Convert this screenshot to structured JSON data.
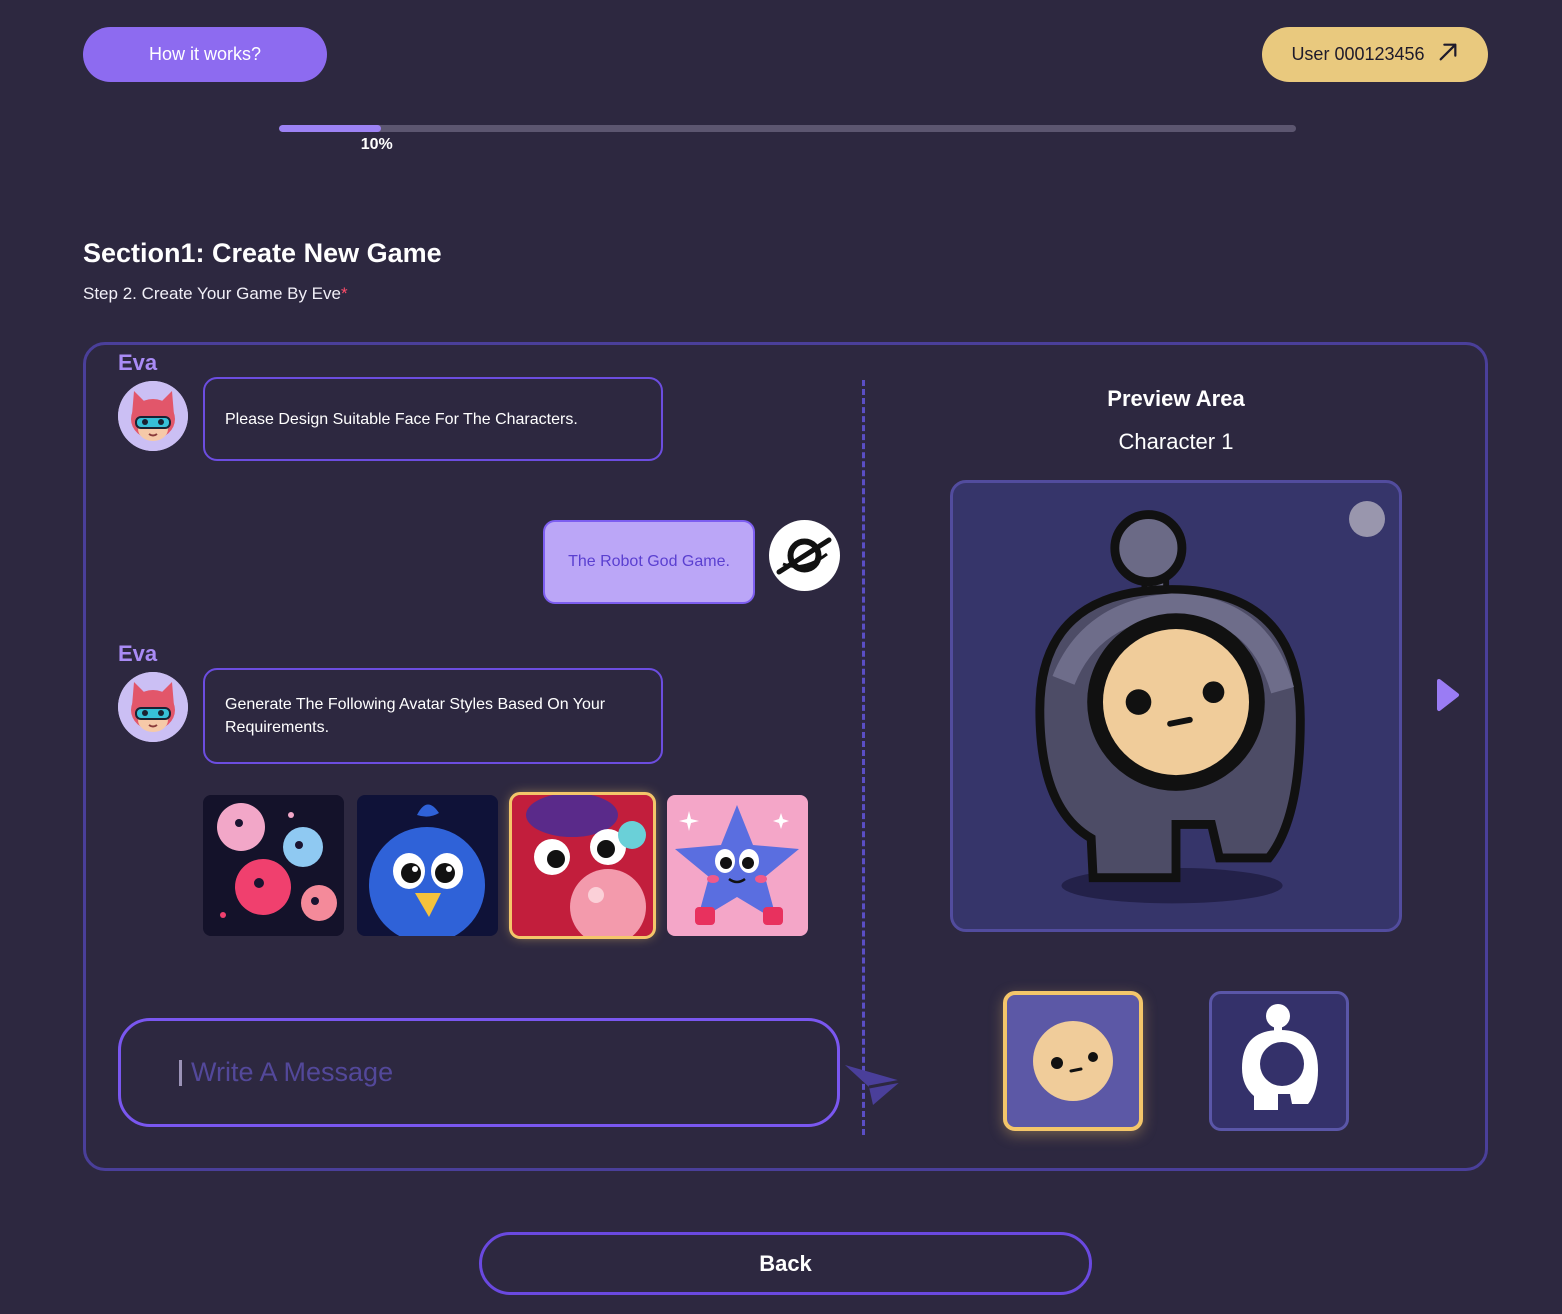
{
  "header": {
    "how_label": "How it works?",
    "user_label": "User 000123456"
  },
  "progress": {
    "value": 0.1,
    "label": "10%"
  },
  "section": {
    "title": "Section1: Create New Game",
    "step": "Step 2. Create Your Game By Eve",
    "required_mark": "*"
  },
  "chat": {
    "messages": [
      {
        "sender": "Eva",
        "text": "Please Design Suitable Face For The Characters."
      },
      {
        "sender": "user",
        "text": "The Robot God Game."
      },
      {
        "sender": "Eva",
        "text": "Generate The Following Avatar Styles Based On Your Requirements."
      }
    ],
    "avatar_styles": [
      "ghost-blobs",
      "blue-bird",
      "red-bubble",
      "blue-star"
    ],
    "selected_style_index": 2,
    "input_placeholder": "Write A Message"
  },
  "preview": {
    "title": "Preview Area",
    "character": "Character 1",
    "options": [
      "face",
      "body"
    ],
    "selected_option": 0
  },
  "footer": {
    "back_label": "Back"
  },
  "colors": {
    "background": "#2d2840",
    "accent": "#8d6bf0",
    "user_badge": "#e9c97e",
    "highlight": "#f4c66a"
  }
}
